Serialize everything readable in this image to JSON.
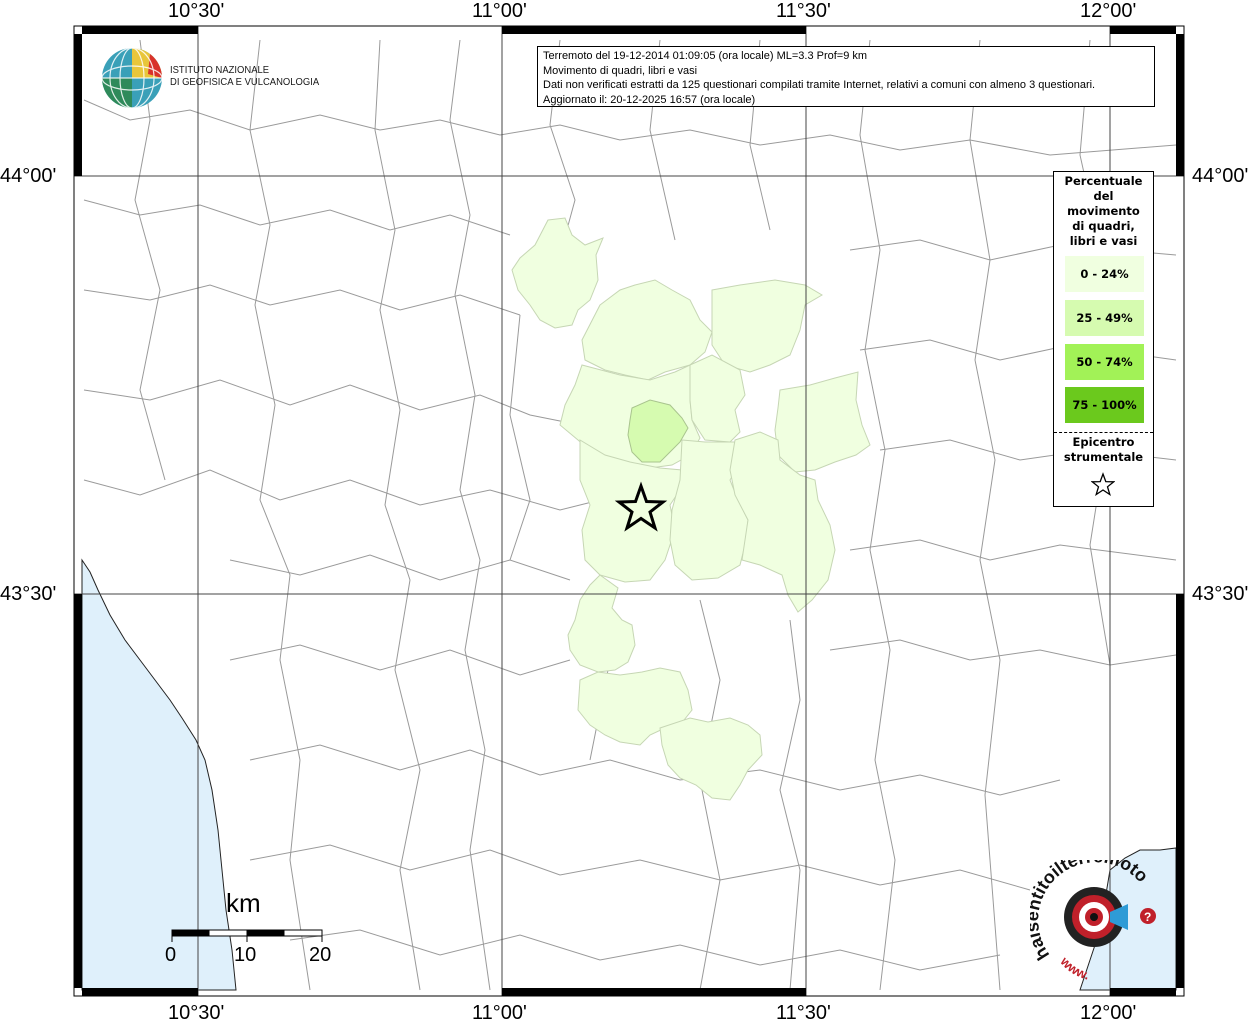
{
  "map": {
    "longitude_labels": [
      "10°30'",
      "11°00'",
      "11°30'",
      "12°00'"
    ],
    "latitude_labels": [
      "44°00'",
      "43°30'"
    ],
    "sea_color": "#dff0fb",
    "land_color": "#ffffff",
    "boundary_color": "#9a9a9a",
    "epicenter_marker": "star-icon"
  },
  "institute": {
    "line1": "ISTITUTO NAZIONALE",
    "line2": "DI GEOFISICA E VULCANOLOGIA"
  },
  "info": {
    "line1": "Terremoto del 19-12-2014 01:09:05 (ora locale) ML=3.3 Prof=9 km",
    "line2": "Movimento di quadri, libri e vasi",
    "line3": "Dati non verificati estratti da 125 questionari compilati tramite Internet, relativi a comuni con almeno 3 questionari.",
    "line4": "Aggiornato il: 20-12-2025 16:57 (ora locale)"
  },
  "legend": {
    "title_lines": [
      "Percentuale",
      "del",
      "movimento",
      "di quadri,",
      "libri e vasi"
    ],
    "classes": [
      {
        "label": "0 - 24%",
        "color": "#f0ffe0"
      },
      {
        "label": "25 - 49%",
        "color": "#d6fbb0"
      },
      {
        "label": "50 - 74%",
        "color": "#a2f257"
      },
      {
        "label": "75 - 100%",
        "color": "#6bc91d"
      }
    ],
    "epicenter_lines": [
      "Epicentro",
      "strumentale"
    ]
  },
  "scale": {
    "unit": "km",
    "ticks": [
      "0",
      "10",
      "20"
    ]
  },
  "watermark": {
    "text_top": "haisentitoilterremoto.it",
    "text_bottom": "www."
  }
}
